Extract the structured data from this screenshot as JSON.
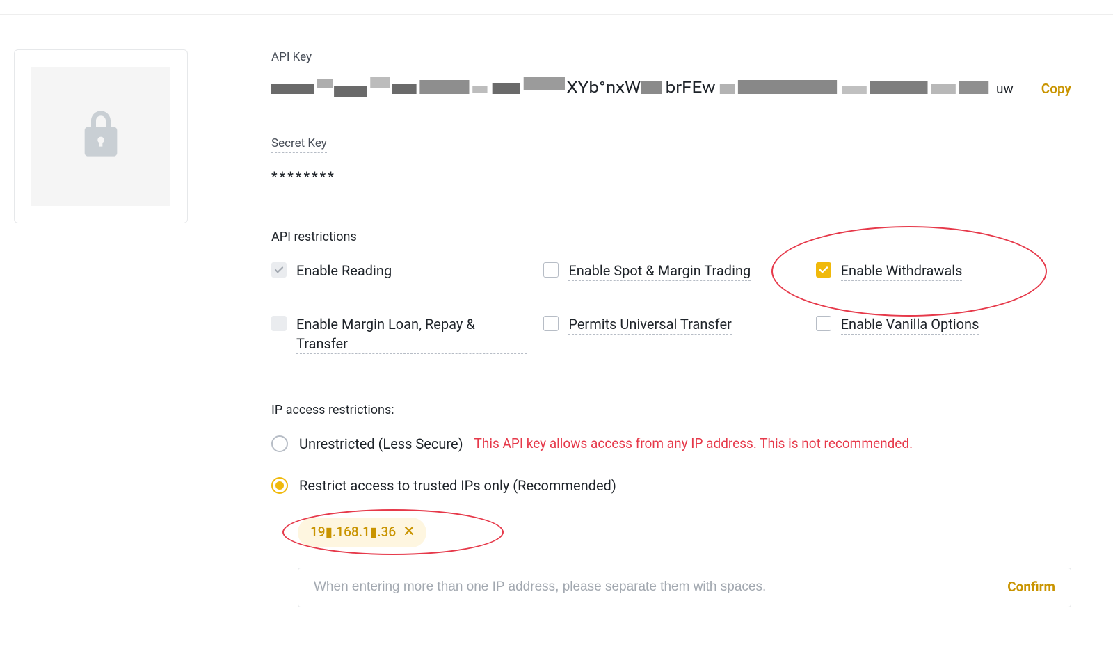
{
  "api_key": {
    "label": "API Key",
    "visible_tail": "uw",
    "copy_label": "Copy"
  },
  "secret_key": {
    "label": "Secret Key",
    "value": "********"
  },
  "restrictions": {
    "label": "API restrictions",
    "reading": "Enable Reading",
    "spot_margin": "Enable Spot & Margin Trading",
    "withdrawals": "Enable Withdrawals",
    "margin_loan": "Enable Margin Loan, Repay & Transfer",
    "universal_transfer": "Permits Universal Transfer",
    "vanilla_options": "Enable Vanilla Options"
  },
  "ip": {
    "label": "IP access restrictions:",
    "unrestricted_label": "Unrestricted (Less Secure)",
    "unrestricted_warning": "This API key allows access from any IP address. This is not recommended.",
    "restrict_label": "Restrict access to trusted IPs only (Recommended)",
    "chip_value": "19▮.168.1▮.36",
    "input_placeholder": "When entering more than one IP address, please separate them with spaces.",
    "confirm_label": "Confirm"
  }
}
